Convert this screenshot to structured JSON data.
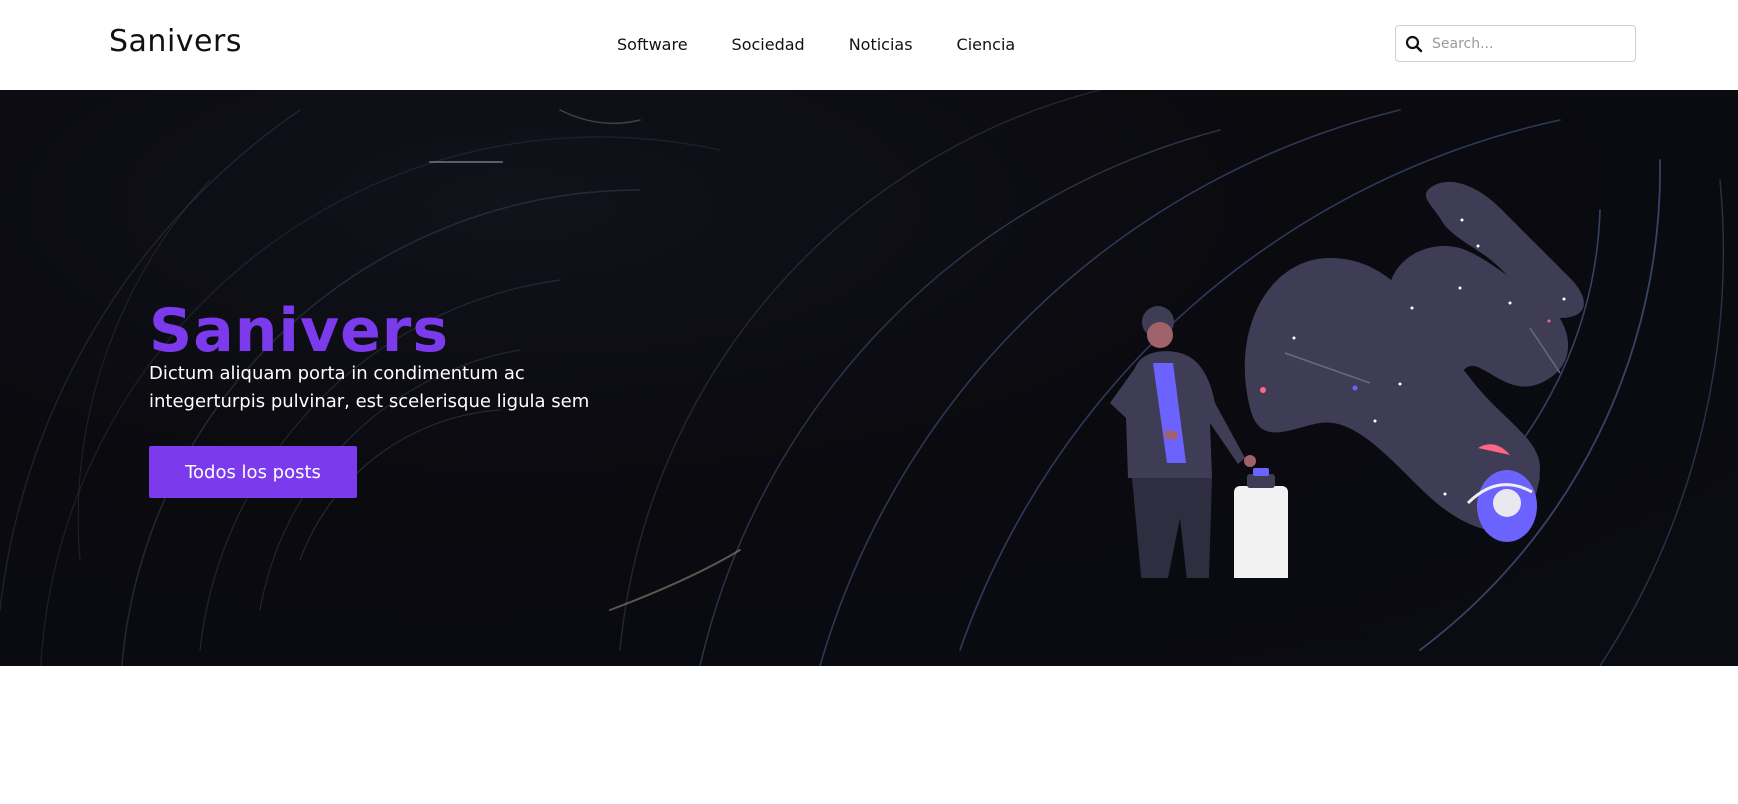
{
  "header": {
    "logo": "Sanivers",
    "nav": [
      {
        "label": "Software"
      },
      {
        "label": "Sociedad"
      },
      {
        "label": "Noticias"
      },
      {
        "label": "Ciencia"
      }
    ],
    "search": {
      "placeholder": "Search...",
      "value": "",
      "icon": "search-icon"
    }
  },
  "hero": {
    "title": "Sanivers",
    "subtitle": "Dictum aliquam porta in condimentum ac integerturpis pulvinar, est scelerisque ligula sem",
    "button": "Todos los posts",
    "illustration": "person-with-space-portal-illustration"
  },
  "colors": {
    "accent": "#7c3aed",
    "hero_background": "#0b0c12",
    "text": "#111111",
    "illustration_primary": "#6c63ff",
    "illustration_dark": "#3f3d56",
    "illustration_accent": "#ff6584"
  }
}
